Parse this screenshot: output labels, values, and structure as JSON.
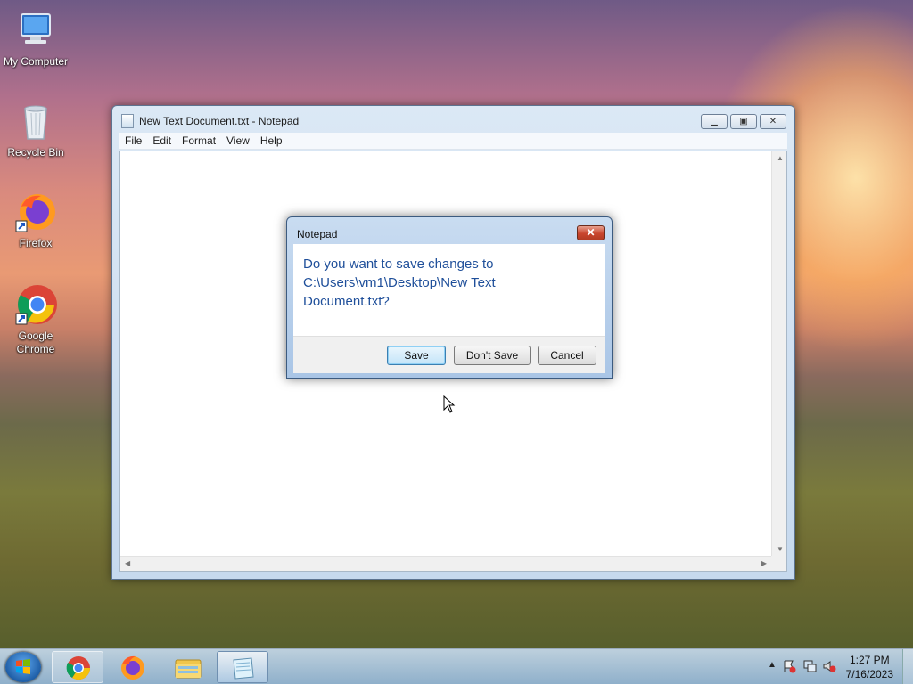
{
  "desktop": {
    "icons": [
      {
        "label": "My Computer"
      },
      {
        "label": "Recycle Bin"
      },
      {
        "label": "Firefox"
      },
      {
        "label": "Google Chrome"
      }
    ]
  },
  "notepad": {
    "title": "New Text Document.txt - Notepad",
    "menu": [
      "File",
      "Edit",
      "Format",
      "View",
      "Help"
    ]
  },
  "dialog": {
    "title": "Notepad",
    "message": "Do you want to save changes to C:\\Users\\vm1\\Desktop\\New Text Document.txt?",
    "buttons": {
      "save": "Save",
      "dont_save": "Don't Save",
      "cancel": "Cancel"
    }
  },
  "taskbar": {
    "apps": [
      "chrome-icon",
      "firefox-icon",
      "file-explorer-icon",
      "notepad-icon"
    ],
    "clock": {
      "time": "1:27 PM",
      "date": "7/16/2023"
    }
  },
  "colors": {
    "dialog_text": "#1f4f9a",
    "close_red": "#c9462e"
  }
}
